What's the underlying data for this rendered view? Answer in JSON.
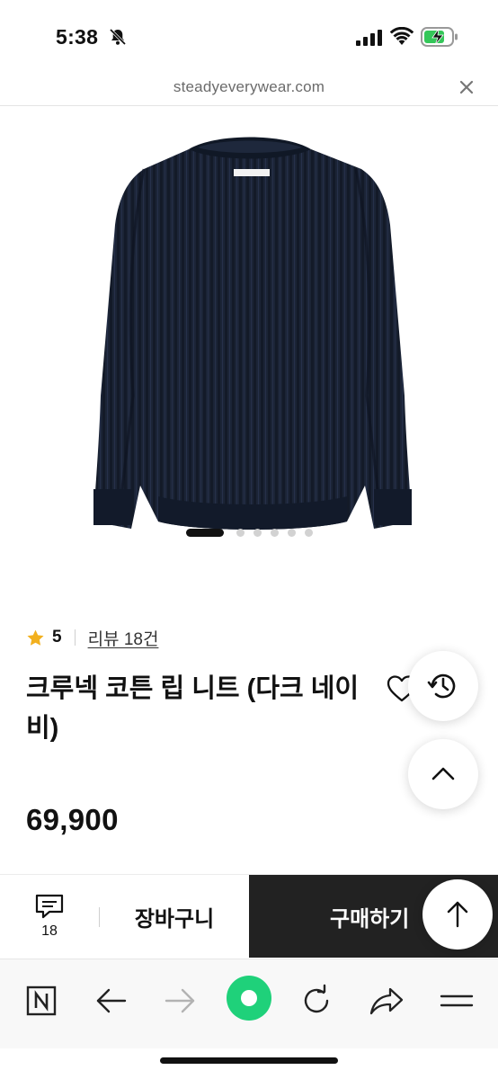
{
  "status_bar": {
    "time": "5:38"
  },
  "browser": {
    "url": "steadyeverywear.com"
  },
  "product": {
    "image_description": "navy ribbed knit sweater",
    "carousel_total": 6,
    "carousel_active": 1,
    "rating": "5",
    "review_label": "리뷰 18건",
    "title": "크루넥 코튼 립 니트 (다크 네이비)",
    "price": "69,900"
  },
  "purchase_bar": {
    "comment_count": "18",
    "cart_label": "장바구니",
    "buy_label": "구매하기"
  },
  "colors": {
    "accent_star": "#f2b01e",
    "buy_bg": "#222222",
    "toolbar_center": "#1fd17a",
    "sweater": "#1b2436"
  },
  "icons": [
    "bell-slash-icon",
    "signal-icon",
    "wifi-icon",
    "battery-charging-icon",
    "close-icon",
    "star-icon",
    "heart-icon",
    "share-icon",
    "history-icon",
    "chevron-up-icon",
    "comment-icon",
    "arrow-up-icon",
    "naver-icon",
    "back-arrow-icon",
    "forward-arrow-icon",
    "green-dot-icon",
    "reload-icon",
    "share-arrow-icon",
    "menu-icon"
  ]
}
